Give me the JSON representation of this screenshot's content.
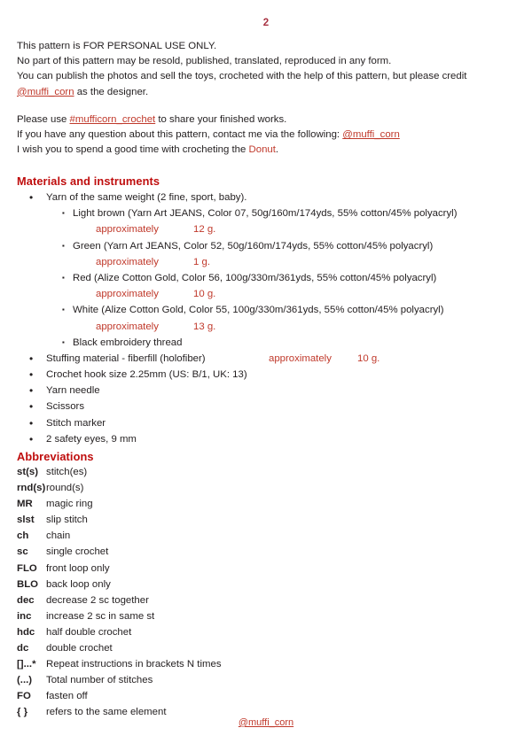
{
  "document": {
    "page_number": "2",
    "footer_handle": "@muffi_corn",
    "accent_heading_color": "#bf0d0d",
    "accent_red_color": "#c0392b",
    "page_number_color": "#a83242"
  },
  "notice": {
    "line1": "This pattern is FOR PERSONAL USE ONLY.",
    "line2": "No part of this pattern may be resold, published, translated, reproduced in any form.",
    "line3_a": "You can publish the photos and sell the toys, crocheted with the help of this pattern, but please credit",
    "line3_link": "@muffi_corn",
    "line3_b": " as the designer.",
    "line4_a": "Please use ",
    "line4_link": "#mufficorn_crochet",
    "line4_b": " to share your finished works.",
    "line5_a": "If you have any question about this pattern,  contact me via the following: ",
    "line5_link": "@muffi_corn",
    "line6_a": "I wish you to spend a good time with crocheting the ",
    "line6_red": "Donut",
    "line6_b": "."
  },
  "materials": {
    "heading": "Materials and instruments",
    "yarn_intro": "Yarn of the same weight (2 fine, sport, baby).",
    "yarns": [
      {
        "description": "Light brown (Yarn Art JEANS, Color 07, 50g/160m/174yds, 55% cotton/45% polyacryl)",
        "approx_label": "approximately",
        "amount": "12 g."
      },
      {
        "description": "Green (Yarn Art JEANS, Color 52, 50g/160m/174yds, 55% cotton/45% polyacryl)",
        "approx_label": "approximately",
        "amount": "1 g."
      },
      {
        "description": "Red (Alize Cotton Gold, Color 56, 100g/330m/361yds, 55% cotton/45% polyacryl)",
        "approx_label": "approximately",
        "amount": "10 g."
      },
      {
        "description": "White (Alize Cotton Gold, Color 55, 100g/330m/361yds, 55% cotton/45% polyacryl)",
        "approx_label": "approximately",
        "amount": "13 g."
      }
    ],
    "black_thread": "Black embroidery thread",
    "stuffing": {
      "label": "Stuffing material - fiberfill (holofiber)",
      "approx_label": "approximately",
      "amount": "10 g."
    },
    "tools": [
      "Crochet hook size 2.25mm (US: B/1, UK: 13)",
      "Yarn needle",
      "Scissors",
      "Stitch marker",
      "2 safety eyes, 9 mm"
    ]
  },
  "abbreviations": {
    "heading": "Abbreviations",
    "rows": [
      {
        "term": "st(s)",
        "definition": "stitch(es)"
      },
      {
        "term": "rnd(s)",
        "definition": "round(s)"
      },
      {
        "term": "MR",
        "definition": "magic ring"
      },
      {
        "term": "slst",
        "definition": "slip stitch"
      },
      {
        "term": "ch",
        "definition": "chain"
      },
      {
        "term": "sc",
        "definition": "single crochet"
      },
      {
        "term": "FLO",
        "definition": "front loop only"
      },
      {
        "term": "BLO",
        "definition": "back loop only"
      },
      {
        "term": "dec",
        "definition": "decrease 2 sc together"
      },
      {
        "term": "inc",
        "definition": "increase 2 sc in same st"
      },
      {
        "term": "hdc",
        "definition": "half double crochet"
      },
      {
        "term": "dc",
        "definition": "double crochet"
      },
      {
        "term": "[]...*",
        "definition": "Repeat instructions in brackets N times"
      },
      {
        "term": "(...)",
        "definition": "Total number of stitches"
      },
      {
        "term": "FO",
        "definition": "fasten off"
      },
      {
        "term": "{ }",
        "definition": "refers to the same element"
      }
    ]
  }
}
